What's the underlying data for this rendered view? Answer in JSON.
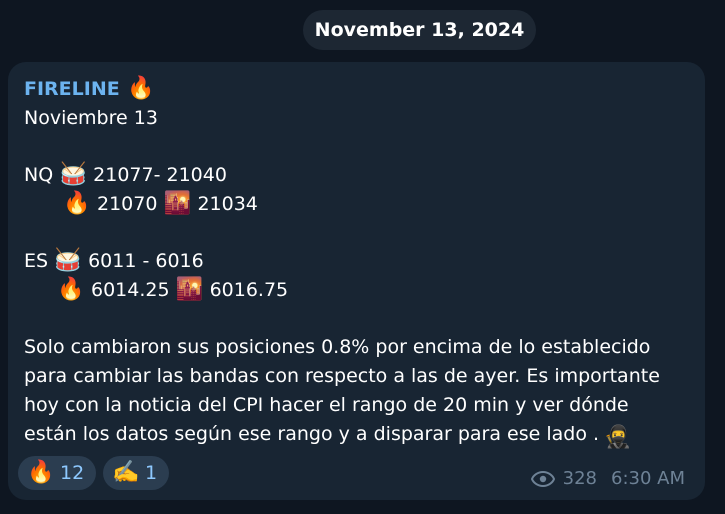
{
  "date_pill": "November 13, 2024",
  "message": {
    "channel_name": "FIRELINE",
    "channel_emoji": "🔥",
    "date_line": "Noviembre 13",
    "nq": {
      "label": "NQ",
      "range": "21077- 21040",
      "value_fire": "21070",
      "value_sunset": "21034"
    },
    "es": {
      "label": "ES",
      "range": "6011 - 6016",
      "value_fire": "6014.25",
      "value_sunset": "6016.75"
    },
    "paragraph": "Solo cambiaron sus posiciones 0.8% por encima de lo establecido para cambiar las bandas con respecto a las de ayer. Es importante hoy con la noticia del CPI hacer el rango de 20 min y ver dónde están los datos según ese rango y a disparar para ese lado .",
    "icons": {
      "fire": "🔥",
      "drum": "🥁",
      "sunset": "🌇",
      "ninja": "🥷",
      "writing_hand": "✍️"
    },
    "reactions": [
      {
        "emoji": "🔥",
        "count": "12"
      },
      {
        "emoji": "✍️",
        "count": "1"
      }
    ],
    "views": "328",
    "time": "6:30 AM"
  },
  "colors": {
    "background": "#0e1621",
    "bubble": "#182533",
    "channel_name": "#6cb3ef",
    "reaction_bg": "#2b3d50",
    "reaction_text": "#8ec9ff",
    "meta_text": "#6e8296"
  }
}
